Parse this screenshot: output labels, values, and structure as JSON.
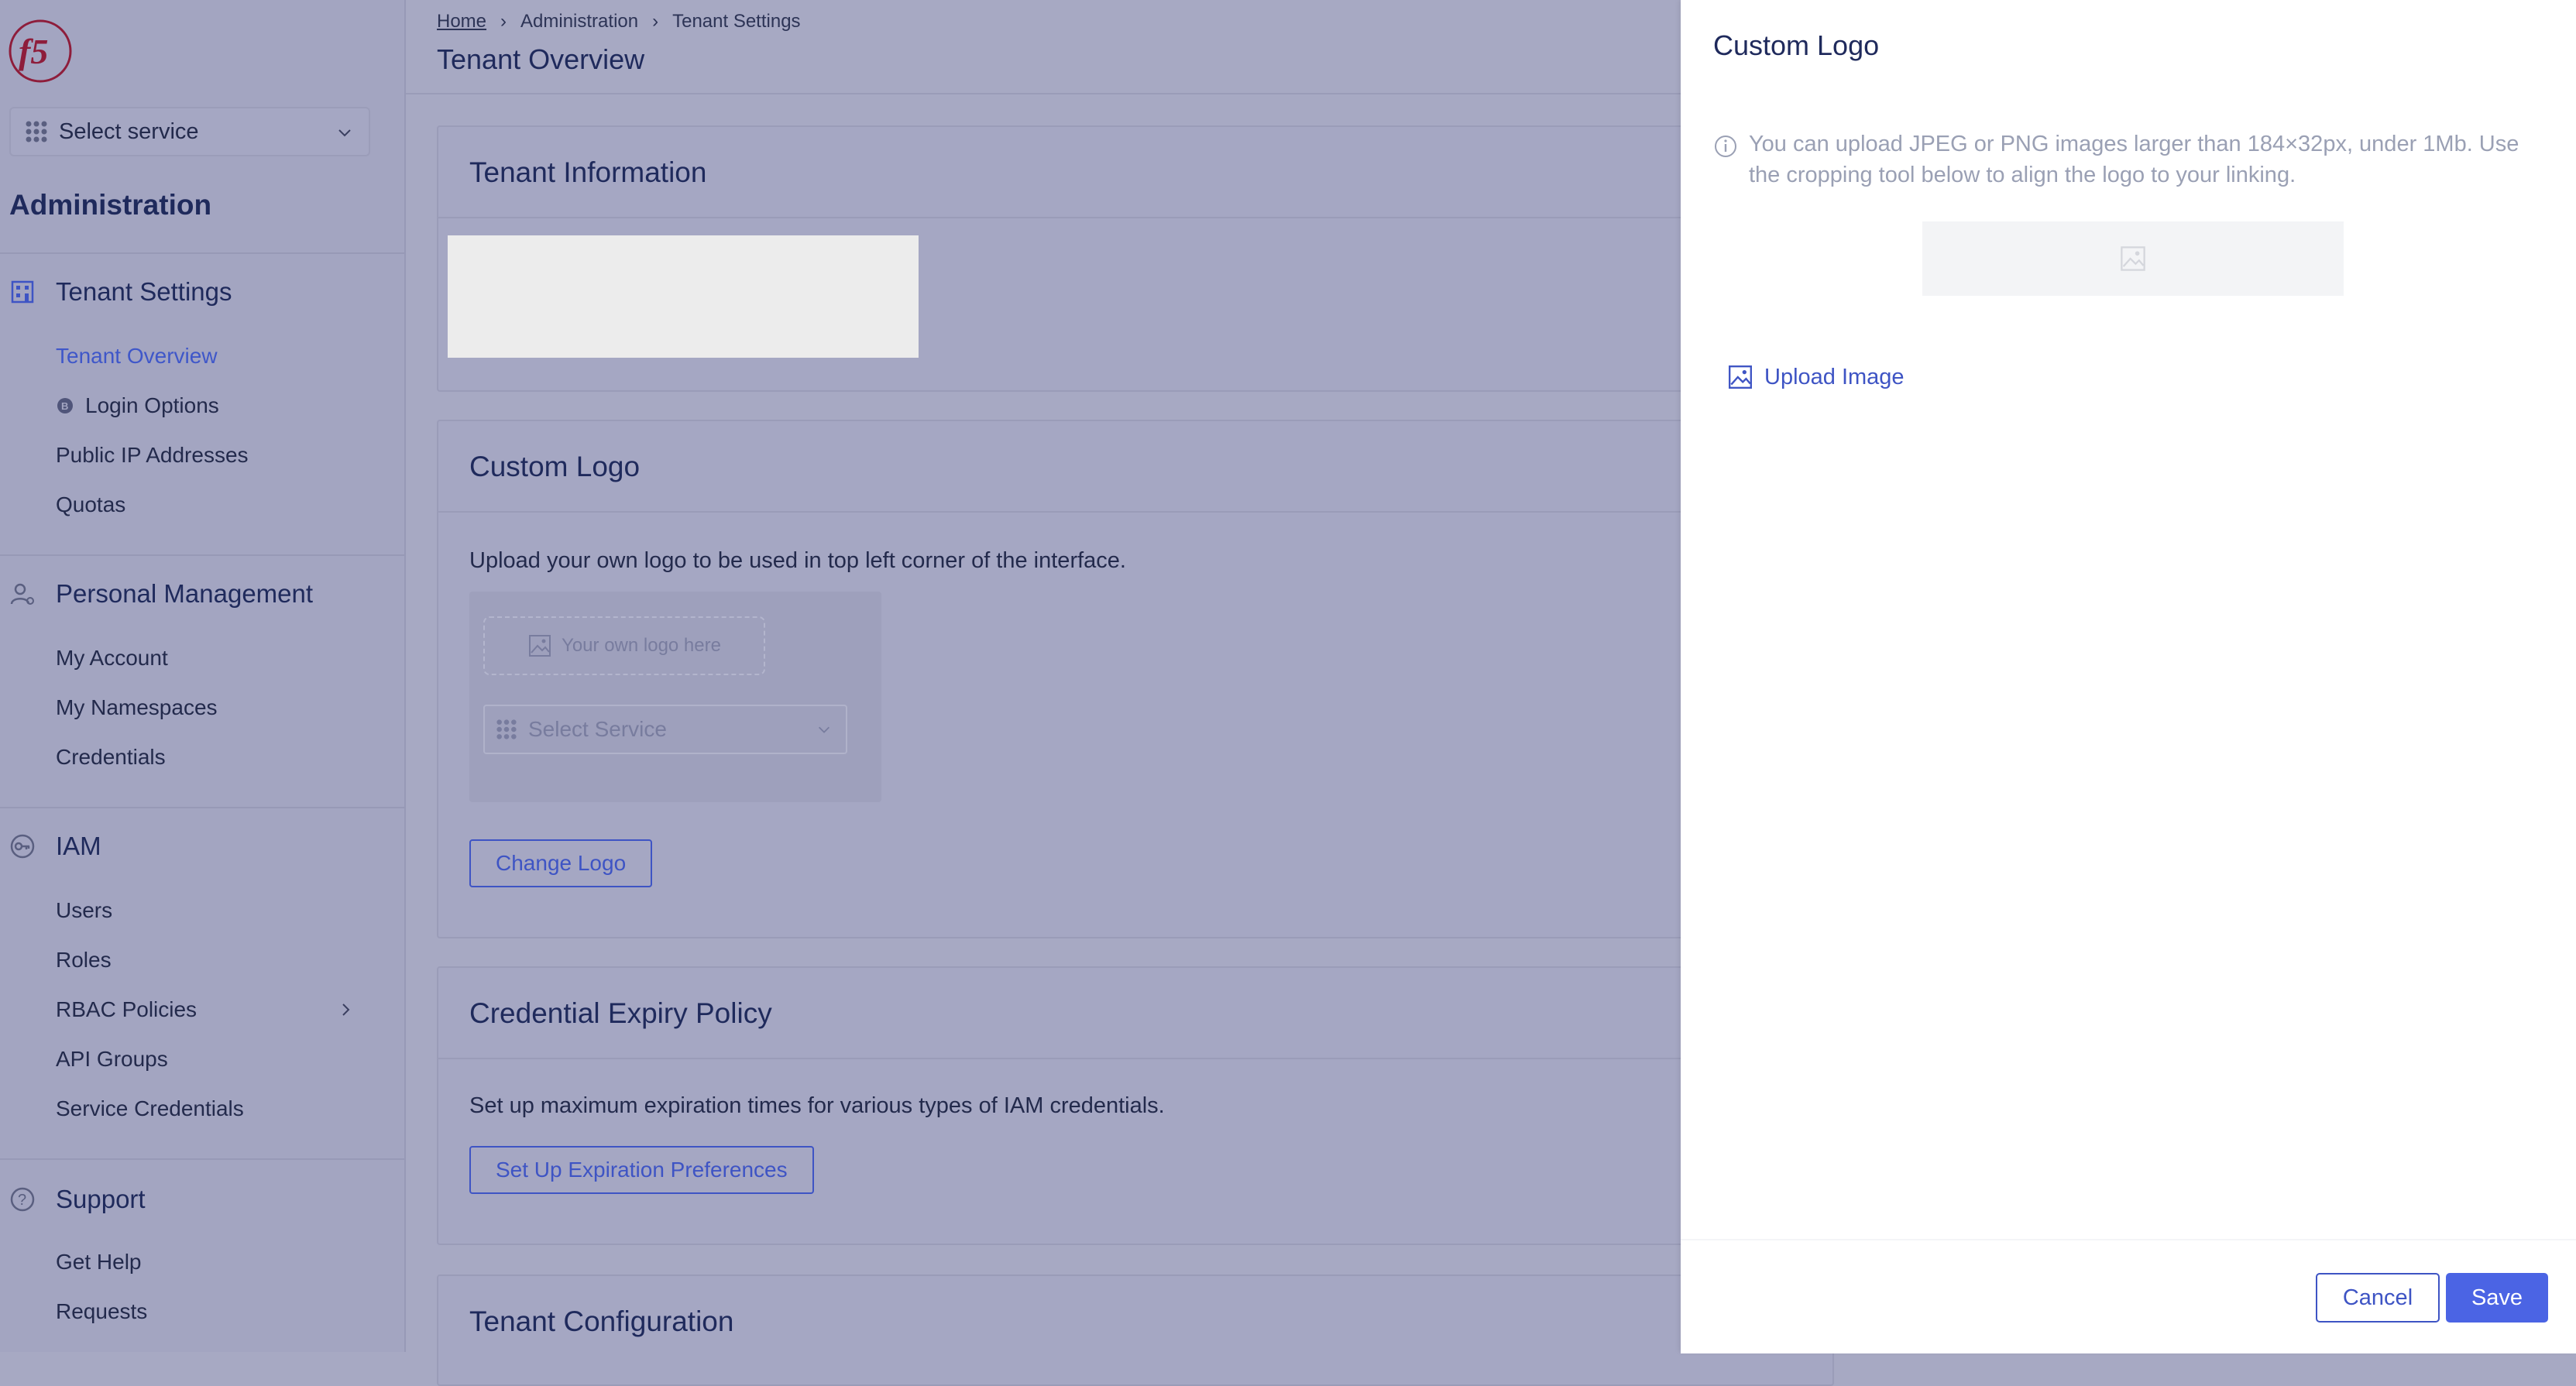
{
  "sidebar": {
    "service_select": "Select service",
    "title": "Administration",
    "sections": {
      "tenant": {
        "label": "Tenant Settings",
        "items": [
          "Tenant Overview",
          "Login Options",
          "Public IP Addresses",
          "Quotas"
        ]
      },
      "personal": {
        "label": "Personal Management",
        "items": [
          "My Account",
          "My Namespaces",
          "Credentials"
        ]
      },
      "iam": {
        "label": "IAM",
        "items": [
          "Users",
          "Roles",
          "RBAC Policies",
          "API Groups",
          "Service Credentials"
        ]
      },
      "support": {
        "label": "Support",
        "items": [
          "Get Help",
          "Requests"
        ]
      }
    }
  },
  "header": {
    "breadcrumb": [
      "Home",
      "Administration",
      "Tenant Settings"
    ],
    "title": "Tenant Overview"
  },
  "cards": {
    "tenant_info": {
      "title": "Tenant Information"
    },
    "custom_logo": {
      "title": "Custom Logo",
      "description": "Upload your own logo to be used in top left corner of the interface.",
      "preview_placeholder": "Your own logo here",
      "preview_select": "Select Service",
      "button": "Change Logo"
    },
    "credential_expiry": {
      "title": "Credential Expiry Policy",
      "description": "Set up maximum expiration times for various types of IAM credentials.",
      "button": "Set Up Expiration Preferences"
    },
    "tenant_config": {
      "title": "Tenant Configuration"
    }
  },
  "drawer": {
    "title": "Custom Logo",
    "info_text": "You can upload JPEG or PNG images larger than 184×32px, under 1Mb. Use the cropping tool below to align the logo to your linking.",
    "upload_label": "Upload Image",
    "cancel_label": "Cancel",
    "save_label": "Save"
  },
  "colors": {
    "accent": "#3e54c4",
    "primary_button": "#4b64e4",
    "brand_red": "#c8102e",
    "overlay": "#a7a9c3"
  }
}
